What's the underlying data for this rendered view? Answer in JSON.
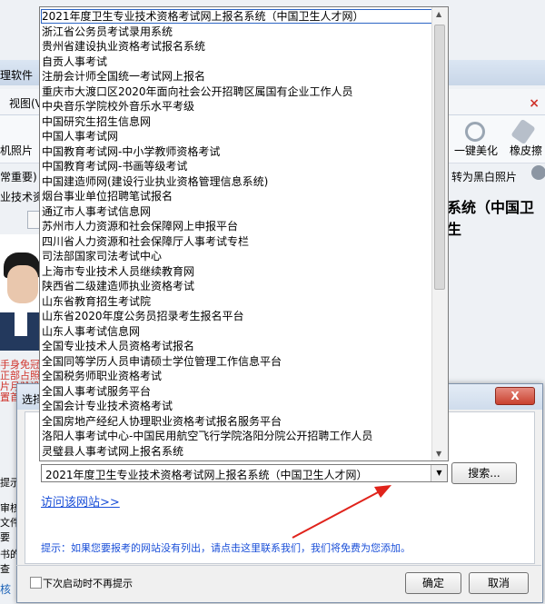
{
  "background": {
    "title_fragment": "理软件",
    "menu_fragment": "视图(V",
    "close_glyph": "×",
    "toolbar": {
      "photo_label": "机照片",
      "beautify_label": "一键美化",
      "eraser_label": "橡皮擦"
    },
    "important_label": "常重要)",
    "to_bw_label": "转为黑白照片",
    "left_text": "业技术资",
    "right_title": "系统（中国卫生",
    "red_text": "手身免冠正部占照片月龄设置首次",
    "side_texts": [
      "提示",
      "审核",
      "文件",
      "要",
      "书的",
      "查"
    ],
    "side_blue": "核 "
  },
  "dialog": {
    "title": "选择",
    "close_label": "X",
    "combo_value": "2021年度卫生专业技术资格考试网上报名系统（中国卫生人才网）",
    "search_label": "搜索...",
    "visit_link": "访问该网站>>",
    "hint": "提示：如果您要报考的网站没有列出，请点击这里联系我们，我们将免费为您添加。",
    "dont_show_label": "下次启动时不再提示",
    "ok_label": "确定",
    "cancel_label": "取消"
  },
  "dropdown": {
    "selected_index": 0,
    "options": [
      "2021年度卫生专业技术资格考试网上报名系统（中国卫生人才网）",
      "浙江省公务员考试录用系统",
      "贵州省建设执业资格考试报名系统",
      "自贡人事考试",
      "注册会计师全国统一考试网上报名",
      "重庆市大渡口区2020年面向社会公开招聘区属国有企业工作人员",
      "中央音乐学院校外音乐水平考级",
      "中国研究生招生信息网",
      "中国人事考试网",
      "中国教育考试网-中小学教师资格考试",
      "中国教育考试网-书画等级考试",
      "中国建造师网(建设行业执业资格管理信息系统)",
      "烟台事业单位招聘笔试报名",
      "通辽市人事考试信息网",
      "苏州市人力资源和社会保障网上申报平台",
      "四川省人力资源和社会保障厅人事考试专栏",
      "司法部国家司法考试中心",
      "上海市专业技术人员继续教育网",
      "陕西省二级建造师执业资格考试",
      "山东省教育招生考试院",
      "山东省2020年度公务员招录考生报名平台",
      "山东人事考试信息网",
      "全国专业技术人员资格考试报名",
      "全国同等学历人员申请硕士学位管理工作信息平台",
      "全国税务师职业资格考试",
      "全国人事考试服务平台",
      "全国会计专业技术资格考试",
      "全国房地产经纪人协理职业资格考试报名服务平台",
      "洛阳人事考试中心-中国民用航空飞行学院洛阳分院公开招聘工作人员",
      "灵璧县人事考试网上报名系统"
    ]
  },
  "colors": {
    "link": "#1a4fd8",
    "arrow": "#e0231b",
    "selection_border": "#2c64c4"
  }
}
